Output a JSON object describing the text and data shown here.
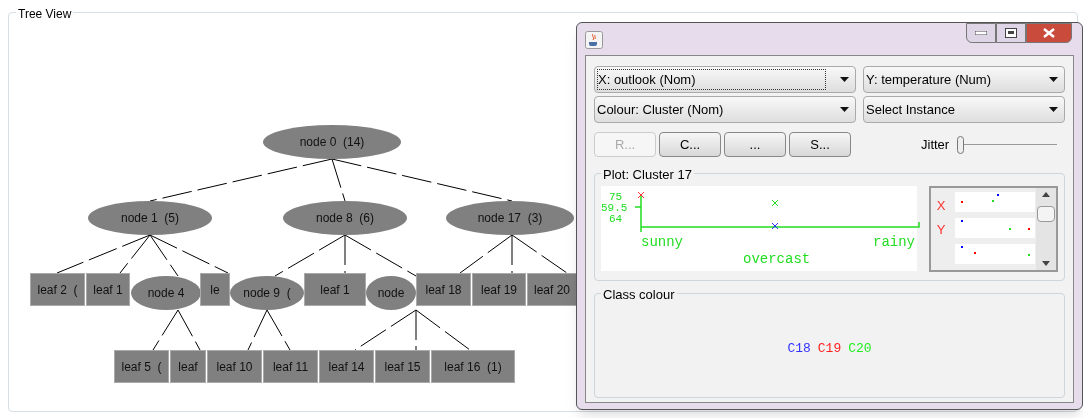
{
  "tree_view": {
    "title": "Tree View",
    "nodes": [
      {
        "kind": "ellipse",
        "label": "node 0  (14)"
      },
      {
        "kind": "ellipse",
        "label": "node 1  (5)"
      },
      {
        "kind": "ellipse",
        "label": "node 8  (6)"
      },
      {
        "kind": "ellipse",
        "label": "node 17  (3)"
      },
      {
        "kind": "leaf",
        "label": "leaf 2  ("
      },
      {
        "kind": "leaf",
        "label": "leaf 1"
      },
      {
        "kind": "ellipse",
        "label": "node 4"
      },
      {
        "kind": "leaf",
        "label": "le"
      },
      {
        "kind": "ellipse",
        "label": "node 9  ("
      },
      {
        "kind": "leaf",
        "label": "leaf 1"
      },
      {
        "kind": "ellipse",
        "label": "node"
      },
      {
        "kind": "leaf",
        "label": "leaf 18"
      },
      {
        "kind": "leaf",
        "label": "leaf 19"
      },
      {
        "kind": "leaf",
        "label": "leaf 20"
      },
      {
        "kind": "leaf",
        "label": "leaf 5  ("
      },
      {
        "kind": "leaf",
        "label": "leaf"
      },
      {
        "kind": "leaf",
        "label": "leaf 10"
      },
      {
        "kind": "leaf",
        "label": "leaf 11"
      },
      {
        "kind": "leaf",
        "label": "leaf 14"
      },
      {
        "kind": "leaf",
        "label": "leaf 15"
      },
      {
        "kind": "leaf",
        "label": "leaf 16  (1)"
      }
    ]
  },
  "window": {
    "combos": [
      {
        "label": "X: outlook (Nom)",
        "focused": true
      },
      {
        "label": "Y: temperature (Num)",
        "focused": false
      },
      {
        "label": "Colour: Cluster (Nom)",
        "focused": false
      },
      {
        "label": "Select Instance",
        "focused": false
      }
    ],
    "buttons": [
      {
        "label": "R...",
        "disabled": true
      },
      {
        "label": "C...",
        "disabled": false
      },
      {
        "label": "...",
        "disabled": false
      },
      {
        "label": "S...",
        "disabled": false
      }
    ],
    "jitter": {
      "label": "Jitter",
      "level": 0
    },
    "plot": {
      "title": "Plot: Cluster 17",
      "y_labels": [
        "75",
        "59.5",
        "64"
      ],
      "categories": [
        "sunny",
        "overcast",
        "rainy"
      ],
      "axis_labels": [
        "X",
        "Y"
      ]
    },
    "class_colour": {
      "title": "Class colour",
      "classes": [
        {
          "label": "C18",
          "color": "#3333ff"
        },
        {
          "label": "C19",
          "color": "#ff2222"
        },
        {
          "label": "C20",
          "color": "#22ee22"
        }
      ]
    }
  }
}
